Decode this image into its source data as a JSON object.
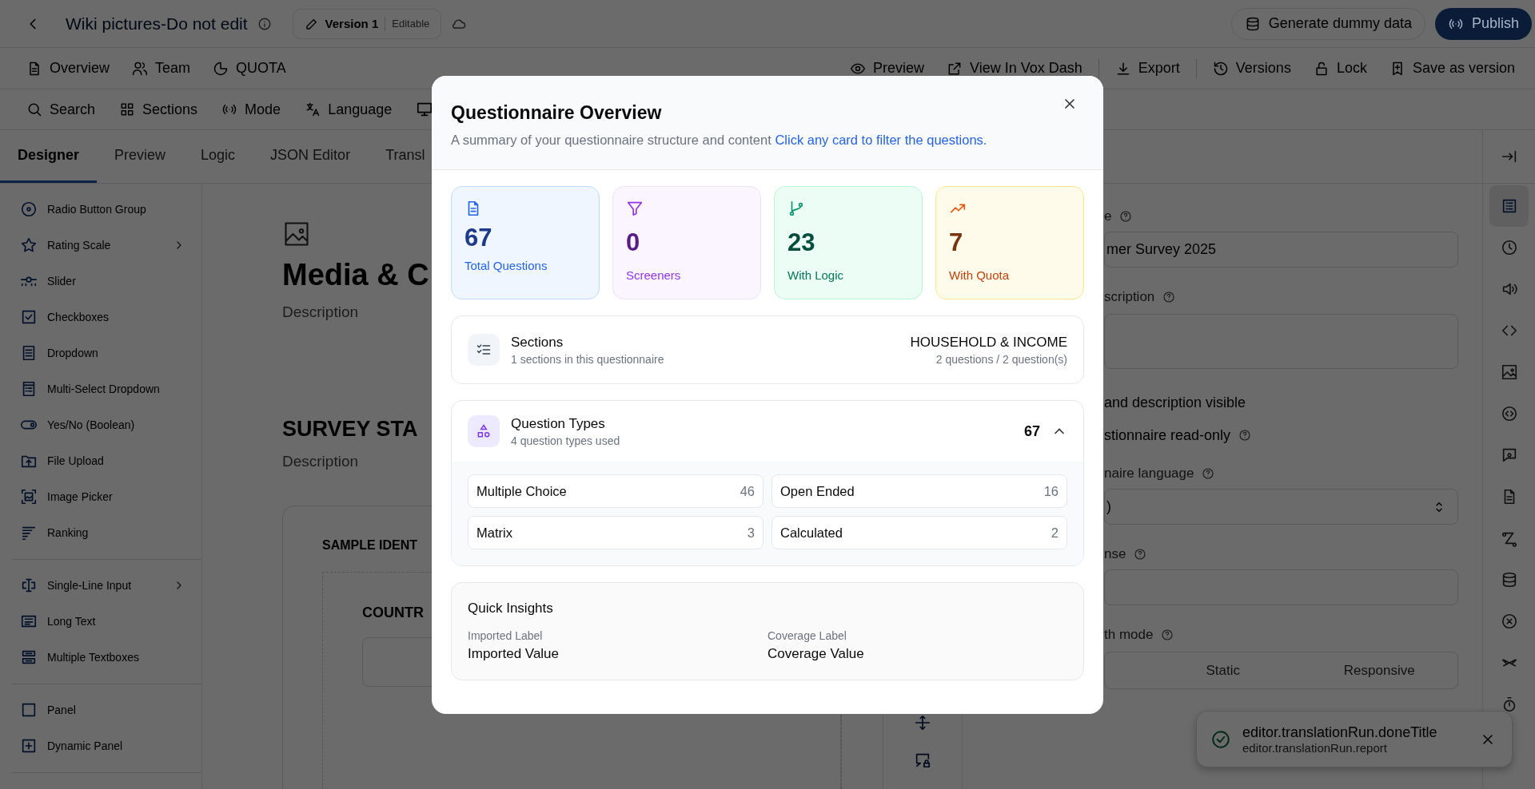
{
  "header": {
    "title": "Wiki pictures-Do not edit",
    "version": "Version 1",
    "version_status": "Editable",
    "actions": [
      {
        "label": "Generate dummy data",
        "kind": "secondary"
      },
      {
        "label": "Publish",
        "kind": "primary"
      }
    ]
  },
  "nav": {
    "left": [
      {
        "label": "Overview"
      },
      {
        "label": "Team"
      },
      {
        "label": "QUOTA"
      }
    ],
    "right": [
      {
        "label": "Preview"
      },
      {
        "label": "View In Vox Dash"
      },
      {
        "label": "Export"
      },
      {
        "label": "Versions"
      },
      {
        "label": "Lock"
      },
      {
        "label": "Save as version"
      }
    ]
  },
  "toolbar": [
    {
      "label": "Search"
    },
    {
      "label": "Sections"
    },
    {
      "label": "Mode"
    },
    {
      "label": "Language"
    }
  ],
  "tabs": [
    {
      "label": "Designer",
      "selected": true
    },
    {
      "label": "Preview",
      "selected": false
    },
    {
      "label": "Logic",
      "selected": false
    },
    {
      "label": "JSON Editor",
      "selected": false
    },
    {
      "label": "Transl",
      "selected": false
    }
  ],
  "palette": [
    [
      {
        "label": "Radio Button Group",
        "submenu": false
      },
      {
        "label": "Rating Scale",
        "submenu": true
      },
      {
        "label": "Slider",
        "submenu": false
      },
      {
        "label": "Checkboxes",
        "submenu": false
      },
      {
        "label": "Dropdown",
        "submenu": false
      },
      {
        "label": "Multi-Select Dropdown",
        "submenu": false
      },
      {
        "label": "Yes/No (Boolean)",
        "submenu": false
      },
      {
        "label": "File Upload",
        "submenu": false
      },
      {
        "label": "Image Picker",
        "submenu": false
      },
      {
        "label": "Ranking",
        "submenu": false
      }
    ],
    [
      {
        "label": "Single-Line Input",
        "submenu": true
      },
      {
        "label": "Long Text",
        "submenu": false
      },
      {
        "label": "Multiple Textboxes",
        "submenu": false
      }
    ],
    [
      {
        "label": "Panel",
        "submenu": false
      },
      {
        "label": "Dynamic Panel",
        "submenu": false
      }
    ]
  ],
  "canvas": {
    "page_title": "Media & C",
    "page_description": "Description",
    "section_title": "SURVEY STA",
    "section_description": "Description",
    "panel_title": "SAMPLE IDENT",
    "question_title": "COUNTR"
  },
  "properties": [
    {
      "kind": "label",
      "text": "e",
      "help": true
    },
    {
      "kind": "input",
      "value": "mer Survey 2025"
    },
    {
      "kind": "label",
      "text": "scription",
      "help": true
    },
    {
      "kind": "textarea"
    },
    {
      "kind": "check",
      "text": "and description visible",
      "help": false
    },
    {
      "kind": "check",
      "text": "stionnaire read-only",
      "help": true
    },
    {
      "kind": "label",
      "text": "naire language",
      "help": true
    },
    {
      "kind": "select",
      "value": ")"
    },
    {
      "kind": "label",
      "text": "nse",
      "help": true
    },
    {
      "kind": "input"
    },
    {
      "kind": "label",
      "text": "th mode",
      "help": true
    },
    {
      "kind": "segmented",
      "options": [
        {
          "label": "Static",
          "selected": false
        },
        {
          "label": "Responsive",
          "selected": false
        }
      ]
    }
  ],
  "rail": [
    {
      "selected": true
    },
    {
      "selected": false
    },
    {
      "selected": false
    },
    {
      "selected": false
    },
    {
      "selected": false
    },
    {
      "selected": false
    },
    {
      "selected": false
    },
    {
      "selected": false
    },
    {
      "selected": false
    },
    {
      "selected": false
    },
    {
      "selected": false
    },
    {
      "selected": false
    },
    {
      "selected": false
    }
  ],
  "modal": {
    "title": "Questionnaire Overview",
    "subtitle": "A summary of your questionnaire structure and content",
    "link": "Click any card to filter the questions.",
    "stats": [
      {
        "kind": "total",
        "value": "67",
        "label": "Total Questions"
      },
      {
        "kind": "screeners",
        "value": "0",
        "label": "Screeners"
      },
      {
        "kind": "logic",
        "value": "23",
        "label": "With Logic"
      },
      {
        "kind": "quota",
        "value": "7",
        "label": "With Quota"
      }
    ],
    "sections": {
      "title": "Sections",
      "subtitle": "1 sections in this questionnaire",
      "name": "HOUSEHOLD & INCOME",
      "counts": "2 questions / 2 question(s)"
    },
    "question_types": {
      "title": "Question Types",
      "subtitle": "4 question types used",
      "total": "67",
      "expanded": true,
      "types": [
        {
          "label": "Multiple Choice",
          "count": "46"
        },
        {
          "label": "Open Ended",
          "count": "16"
        },
        {
          "label": "Matrix",
          "count": "3"
        },
        {
          "label": "Calculated",
          "count": "2"
        }
      ]
    },
    "insights": {
      "title": "Quick Insights",
      "items": [
        {
          "label": "Imported Label",
          "value": "Imported Value"
        },
        {
          "label": "Coverage Label",
          "value": "Coverage Value"
        }
      ]
    }
  },
  "toast": {
    "title": "editor.translationRun.doneTitle",
    "message": "editor.translationRun.report"
  }
}
